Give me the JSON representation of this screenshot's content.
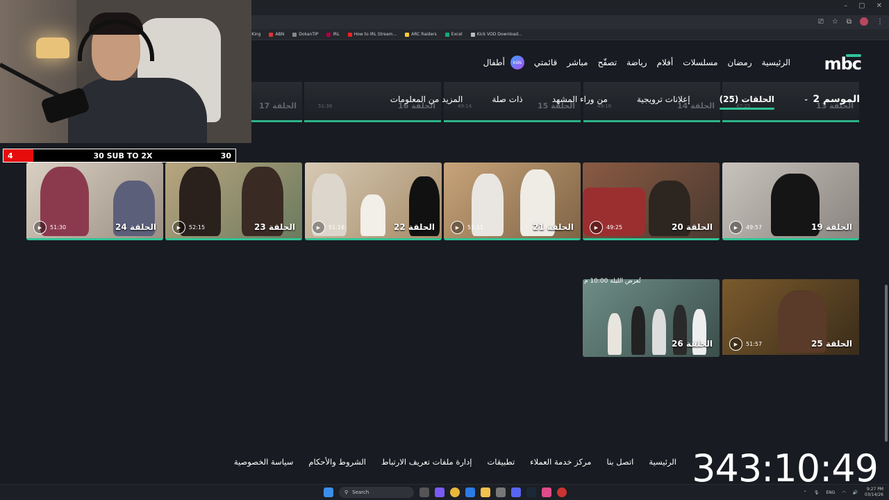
{
  "browser": {
    "bookmarks": [
      "t King",
      "ABN",
      "DokanTIP",
      "IRL",
      "How to IRL Stream...",
      "ARC Raiders",
      "Excel",
      "Kick VOD Download..."
    ],
    "window_controls": [
      "–",
      "▢",
      "✕"
    ]
  },
  "header": {
    "logo": "mbc",
    "nav": [
      "الرئيسية",
      "رمضان",
      "مسلسلات",
      "أفلام",
      "رياضة",
      "تصفّح",
      "مباشر",
      "قائمتي"
    ],
    "kids_label": "أطفال",
    "kids_badge": "kids"
  },
  "tabs": {
    "season": "الموسم 2",
    "items": [
      "الحلقات (25)",
      "إعلانات ترويجية",
      "من وراء المشهد",
      "ذات صلة",
      "المزيد من المعلومات"
    ],
    "active_index": 0
  },
  "ghost_row": [
    {
      "title": "الحلقة 13",
      "duration": "47:25"
    },
    {
      "title": "الحلقة 14",
      "duration": "49:16"
    },
    {
      "title": "الحلقة 15",
      "duration": "49:14"
    },
    {
      "title": "الحلقة 16",
      "duration": "51:38"
    },
    {
      "title": "الحلقة 17",
      "duration": ""
    }
  ],
  "episodes_row1": [
    {
      "title": "الحلقة 19",
      "duration": "49:57"
    },
    {
      "title": "الحلقة 20",
      "duration": "49:25"
    },
    {
      "title": "الحلقة 21",
      "duration": "52:11"
    },
    {
      "title": "الحلقة 22",
      "duration": "51:16"
    },
    {
      "title": "الحلقة 23",
      "duration": "52:15"
    },
    {
      "title": "الحلقة 24",
      "duration": "51:30"
    }
  ],
  "episodes_row2": [
    {
      "title": "الحلقة 25",
      "duration": "51:57",
      "badge": ""
    },
    {
      "title": "الحلقة 26",
      "duration": "",
      "badge": "تُعرض الليلة 10:00 م"
    }
  ],
  "overlay": {
    "sub_left": "4",
    "sub_text": "30 SUB TO 2X",
    "sub_right": "30",
    "sub_progress": 0.13,
    "timer": "343:10:49"
  },
  "footer": [
    "الرئيسية",
    "اتصل بنا",
    "مركز خدمة العملاء",
    "تطبيقات",
    "إدارة ملفات تعريف الارتباط",
    "الشروط والأحكام",
    "سياسة الخصوصية"
  ],
  "taskbar": {
    "search": "Search",
    "lang": "ENG",
    "time": "9:27 PM",
    "date": "03/14/26"
  },
  "colors": {
    "accent": "#2fc596",
    "background": "#181b21",
    "sub_fill": "#e60c0c"
  }
}
